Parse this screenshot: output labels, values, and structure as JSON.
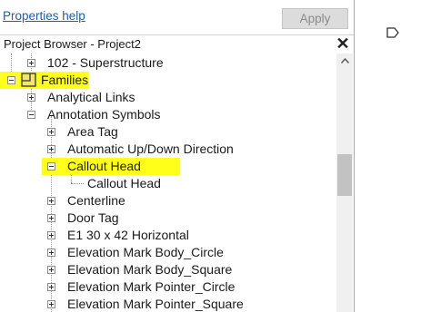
{
  "top": {
    "help_link": "Properties help",
    "apply_label": "Apply"
  },
  "browser": {
    "title": "Project Browser - Project2",
    "close_glyph": "✕"
  },
  "tree": [
    {
      "label": "102 - Superstructure",
      "state": "collapsed"
    },
    {
      "label": "Families",
      "state": "expanded",
      "icon": "folder-icon",
      "highlighted": true
    },
    {
      "label": "Analytical Links",
      "state": "collapsed"
    },
    {
      "label": "Annotation Symbols",
      "state": "expanded"
    },
    {
      "label": "Area Tag",
      "state": "collapsed"
    },
    {
      "label": "Automatic Up/Down Direction",
      "state": "collapsed"
    },
    {
      "label": "Callout Head",
      "state": "expanded",
      "highlighted": true
    },
    {
      "label": "Callout Head",
      "state": "leaf"
    },
    {
      "label": "Centerline",
      "state": "collapsed"
    },
    {
      "label": "Door Tag",
      "state": "collapsed"
    },
    {
      "label": "E1 30 x 42 Horizontal",
      "state": "collapsed"
    },
    {
      "label": "Elevation Mark Body_Circle",
      "state": "collapsed"
    },
    {
      "label": "Elevation Mark Body_Square",
      "state": "collapsed"
    },
    {
      "label": "Elevation Mark Pointer_Circle",
      "state": "collapsed"
    },
    {
      "label": "Elevation Mark Pointer_Square",
      "state": "collapsed"
    }
  ],
  "colors": {
    "highlight": "#ffff1a",
    "link": "#1a5fb4"
  },
  "icons": {
    "scroll_up": "chevron-up-icon",
    "side": "tag-outline-icon"
  }
}
